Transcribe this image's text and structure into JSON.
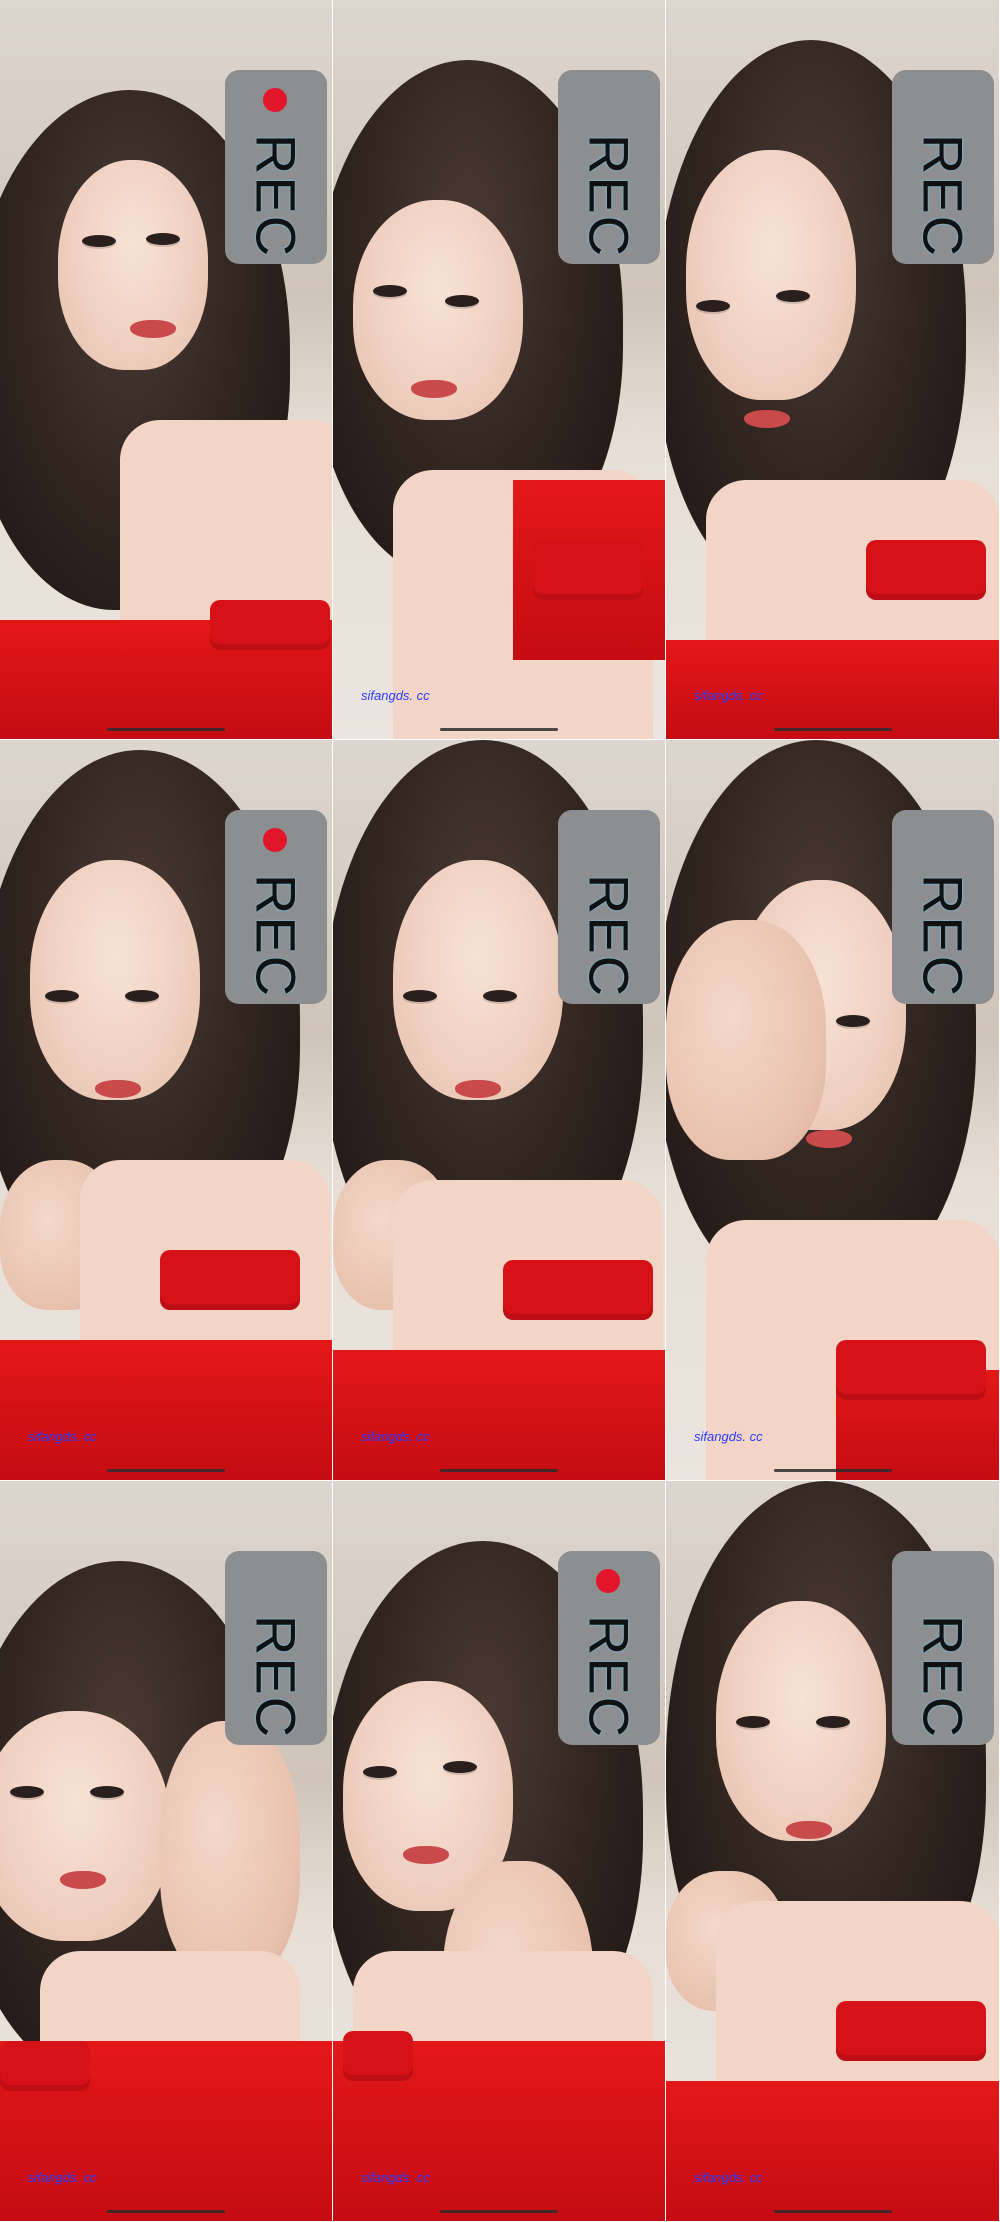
{
  "tiles": [
    {
      "rec": "REC",
      "watermark": "",
      "show_dot": true
    },
    {
      "rec": "REC",
      "watermark": "sifangds. cc",
      "show_dot": false
    },
    {
      "rec": "REC",
      "watermark": "sifangds. cc",
      "show_dot": false
    },
    {
      "rec": "REC",
      "watermark": "sifangds. cc",
      "show_dot": true
    },
    {
      "rec": "REC",
      "watermark": "sifangds. cc",
      "show_dot": false
    },
    {
      "rec": "REC",
      "watermark": "sifangds. cc",
      "show_dot": false
    },
    {
      "rec": "REC",
      "watermark": "sifangds. cc",
      "show_dot": false
    },
    {
      "rec": "REC",
      "watermark": "sifangds. cc",
      "show_dot": true
    },
    {
      "rec": "REC",
      "watermark": "sifangds. cc",
      "show_dot": false
    }
  ],
  "colors": {
    "rec_badge": "#8d8e90",
    "rec_dot": "#e1162a",
    "dress": "#d61117",
    "watermark": "#2b3bff"
  }
}
